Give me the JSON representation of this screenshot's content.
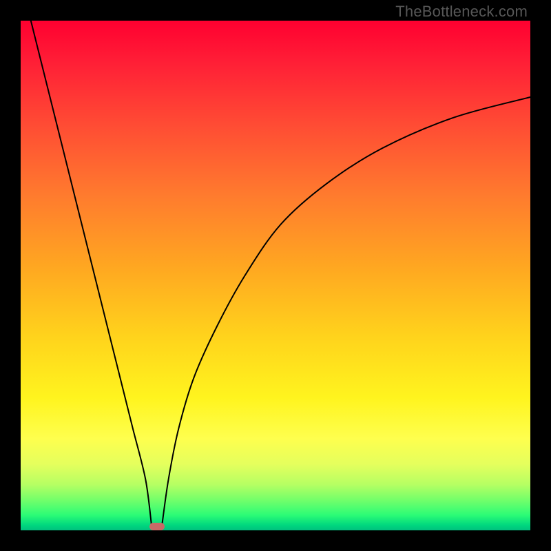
{
  "watermark": "TheBottleneck.com",
  "chart_data": {
    "type": "line",
    "title": "",
    "xlabel": "",
    "ylabel": "",
    "xlim": [
      0,
      100
    ],
    "ylim": [
      0,
      100
    ],
    "series": [
      {
        "name": "curve-left",
        "x": [
          2.0,
          4.5,
          7.0,
          9.5,
          12.0,
          14.5,
          17.0,
          19.5,
          22.0,
          24.5,
          25.7
        ],
        "values": [
          100,
          90,
          80,
          70,
          60,
          50,
          40,
          30,
          20,
          10,
          0.8
        ]
      },
      {
        "name": "curve-right",
        "x": [
          27.7,
          29.0,
          31.0,
          34.0,
          38.5,
          44.0,
          51.0,
          60.0,
          71.0,
          85.0,
          100
        ],
        "values": [
          0.8,
          10,
          20,
          30,
          40,
          50,
          60,
          68,
          75,
          81,
          85
        ]
      }
    ],
    "marker": {
      "x": 26.8,
      "y": 0.8
    },
    "gradient_stops": [
      {
        "pos": 0,
        "color": "#ff0030"
      },
      {
        "pos": 50,
        "color": "#ffb020"
      },
      {
        "pos": 78,
        "color": "#fff41e"
      },
      {
        "pos": 100,
        "color": "#00c07e"
      }
    ]
  }
}
